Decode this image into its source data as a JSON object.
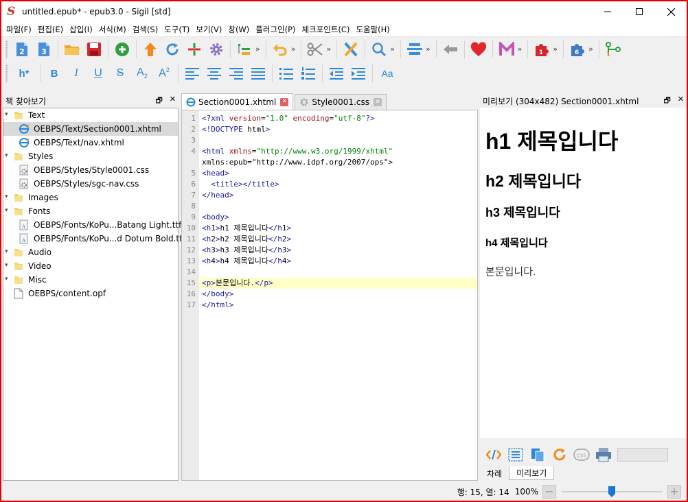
{
  "window": {
    "title": "untitled.epub* - epub3.0 - Sigil [std]",
    "logo_letter": "S"
  },
  "menu": [
    "파일(F)",
    "편집(E)",
    "삽입(I)",
    "서식(M)",
    "검색(S)",
    "도구(T)",
    "보기(V)",
    "창(W)",
    "플러그인(P)",
    "체크포인트(C)",
    "도움말(H)"
  ],
  "toolbar_top": {
    "icons": [
      "epub2-new-icon",
      "epub3-new-icon",
      "folder-open-icon",
      "save-icon",
      "add-file-icon",
      "move-up-icon",
      "refresh-icon",
      "split-icon",
      "gear-icon",
      "outline-icon",
      "undo-icon",
      "cut-icon",
      "validation-icon",
      "search-icon",
      "reports-icon",
      "back-icon",
      "heart-icon",
      "metadata-icon",
      "plugin-red-icon",
      "plugin-blue-icon",
      "tree-icon"
    ],
    "overflow_glyph": "»"
  },
  "toolbar_format": {
    "heading_label": "h*",
    "bold": "B",
    "italic": "I",
    "underline": "U",
    "strike": "S",
    "subscript_base": "A",
    "subscript_mark": "2",
    "superscript_base": "A",
    "superscript_mark": "2",
    "case_label": "Aa"
  },
  "book_browser": {
    "title": "책 찾아보기",
    "items": [
      {
        "label": "Text",
        "type": "folder",
        "level": 0
      },
      {
        "label": "OEBPS/Text/Section0001.xhtml",
        "type": "xhtml",
        "level": 1,
        "selected": true
      },
      {
        "label": "OEBPS/Text/nav.xhtml",
        "type": "xhtml",
        "level": 1
      },
      {
        "label": "Styles",
        "type": "folder",
        "level": 0
      },
      {
        "label": "OEBPS/Styles/Style0001.css",
        "type": "css",
        "level": 1
      },
      {
        "label": "OEBPS/Styles/sgc-nav.css",
        "type": "css",
        "level": 1
      },
      {
        "label": "Images",
        "type": "folder",
        "level": 0
      },
      {
        "label": "Fonts",
        "type": "folder",
        "level": 0
      },
      {
        "label": "OEBPS/Fonts/KoPu...Batang Light.ttf",
        "type": "font",
        "level": 1
      },
      {
        "label": "OEBPS/Fonts/KoPu...d Dotum Bold.ttf",
        "type": "font",
        "level": 1
      },
      {
        "label": "Audio",
        "type": "folder",
        "level": 0
      },
      {
        "label": "Video",
        "type": "folder",
        "level": 0
      },
      {
        "label": "Misc",
        "type": "folder",
        "level": 0
      },
      {
        "label": "OEBPS/content.opf",
        "type": "file",
        "level": 0
      }
    ]
  },
  "editor": {
    "tabs": [
      {
        "label": "Section0001.xhtml",
        "active": true
      },
      {
        "label": "Style0001.css",
        "active": false
      }
    ],
    "close_glyph": "✕",
    "highlight_line": 15,
    "lines": [
      {
        "n": "1",
        "text": "<?xml version=\"1.0\" encoding=\"utf-8\"?>"
      },
      {
        "n": "2",
        "text": "<!DOCTYPE html>"
      },
      {
        "n": "3",
        "text": ""
      },
      {
        "n": "4",
        "text": "<html xmlns=\"http://www.w3.org/1999/xhtml\""
      },
      {
        "n": "",
        "text": "xmlns:epub=\"http://www.idpf.org/2007/ops\">"
      },
      {
        "n": "5",
        "text": "<head>"
      },
      {
        "n": "6",
        "text": "  <title></title>"
      },
      {
        "n": "7",
        "text": "</head>"
      },
      {
        "n": "8",
        "text": ""
      },
      {
        "n": "9",
        "text": "<body>"
      },
      {
        "n": "10",
        "text": "<h1>h1 제목입니다</h1>"
      },
      {
        "n": "11",
        "text": "<h2>h2 제목입니다</h2>"
      },
      {
        "n": "12",
        "text": "<h3>h3 제목입니다</h3>"
      },
      {
        "n": "13",
        "text": "<h4>h4 제목입니다</h4>"
      },
      {
        "n": "14",
        "text": ""
      },
      {
        "n": "15",
        "text": "<p>본문입니다.</p>"
      },
      {
        "n": "16",
        "text": "</body>"
      },
      {
        "n": "17",
        "text": "</html>"
      }
    ]
  },
  "preview": {
    "title": "미리보기 (304x482) Section0001.xhtml",
    "h1": "h1 제목입니다",
    "h2": "h2 제목입니다",
    "h3": "h3 제목입니다",
    "h4": "h4 제목입니다",
    "p": "본문입니다.",
    "css_label": "CSS",
    "bottom_tabs": [
      "차례",
      "미리보기"
    ],
    "active_bottom_tab": "미리보기"
  },
  "status": {
    "position": "행: 15, 열: 14",
    "zoom": "100%",
    "zoom_minus": "−",
    "zoom_plus": "+",
    "zoom_fraction": 0.5
  },
  "colors": {
    "window_border": "#e60000",
    "highlight_line": "#ffffc8",
    "tag_blue": "#1a1aa6",
    "attr_red": "#a31515",
    "value_green": "#008000",
    "format_blue": "#2b88d8"
  }
}
